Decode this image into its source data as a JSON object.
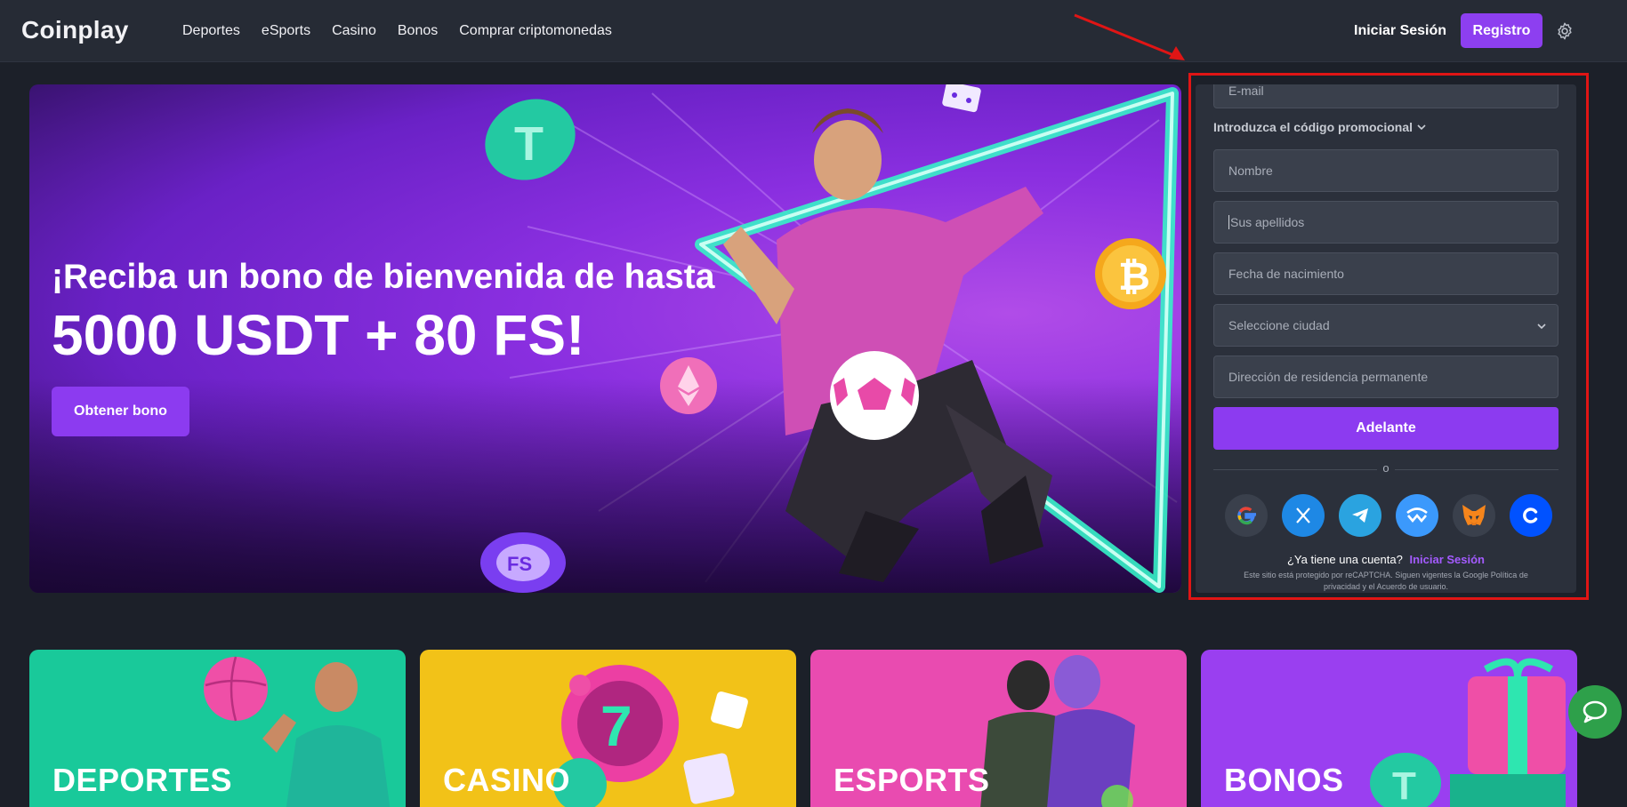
{
  "header": {
    "logo": "Coinplay",
    "nav": [
      "Deportes",
      "eSports",
      "Casino",
      "Bonos",
      "Comprar criptomonedas"
    ],
    "login_label": "Iniciar Sesión",
    "register_label": "Registro",
    "settings_icon": "gear-icon"
  },
  "hero": {
    "title_line1": "¡Reciba un bono de bienvenida de hasta",
    "title_line2": "5000 USDT + 80 FS!",
    "cta_label": "Obtener bono"
  },
  "registration": {
    "email_placeholder": "E-mail",
    "promo_toggle": "Introduzca el código promocional",
    "first_name_placeholder": "Nombre",
    "last_name_placeholder": "Sus apellidos",
    "birthdate_placeholder": "Fecha de nacimiento",
    "city_placeholder": "Seleccione ciudad",
    "address_placeholder": "Dirección de residencia permanente",
    "submit_label": "Adelante",
    "divider_text": "o",
    "social_providers": [
      "google-icon",
      "x-icon",
      "telegram-icon",
      "walletconnect-icon",
      "metamask-icon",
      "coinbase-icon"
    ],
    "have_account_text": "¿Ya tiene una cuenta?",
    "have_account_link": "Iniciar Sesión",
    "recaptcha_text": "Este sitio está protegido por reCAPTCHA. Siguen vigentes la Google Política de privacidad y el Acuerdo de usuario."
  },
  "categories": [
    {
      "label": "DEPORTES",
      "color": "#19c99a"
    },
    {
      "label": "CASINO",
      "color": "#f2c218"
    },
    {
      "label": "ESPORTS",
      "color": "#e94bb0"
    },
    {
      "label": "BONOS",
      "color": "#9a3ff0"
    }
  ],
  "colors": {
    "accent": "#8c3bf0",
    "highlight_border": "#e01515",
    "chat": "#2ea04a"
  },
  "chat_icon": "chat-bubble-icon"
}
